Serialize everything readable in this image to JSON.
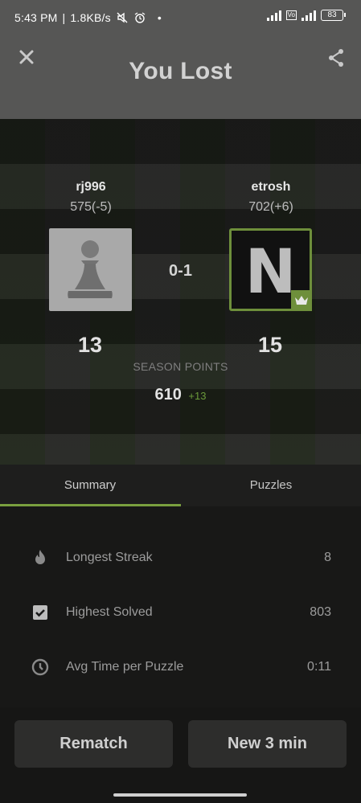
{
  "status_bar": {
    "time": "5:43 PM",
    "net_speed": "1.8KB/s",
    "battery": "83"
  },
  "header": {
    "title": "You Lost",
    "close_icon": "close-icon",
    "share_icon": "share-icon"
  },
  "match": {
    "player1": {
      "name": "rj996",
      "rating": "575(-5)",
      "points": "13"
    },
    "player2": {
      "name": "etrosh",
      "rating": "702(+6)",
      "points": "15",
      "avatar_letter": "N"
    },
    "score": "0-1",
    "season_label": "SEASON POINTS",
    "season_total": "610",
    "season_delta": "+13"
  },
  "tabs": [
    {
      "label": "Summary"
    },
    {
      "label": "Puzzles"
    }
  ],
  "summary": [
    {
      "icon": "flame-icon",
      "label": "Longest Streak",
      "value": "8"
    },
    {
      "icon": "checkbox-icon",
      "label": "Highest Solved",
      "value": "803"
    },
    {
      "icon": "clock-icon",
      "label": "Avg Time per Puzzle",
      "value": "0:11"
    }
  ],
  "actions": {
    "rematch": "Rematch",
    "new_game": "New 3 min"
  },
  "colors": {
    "accent": "#7aa03f",
    "header_bg": "#565655",
    "button_bg": "#2d2d2c"
  }
}
